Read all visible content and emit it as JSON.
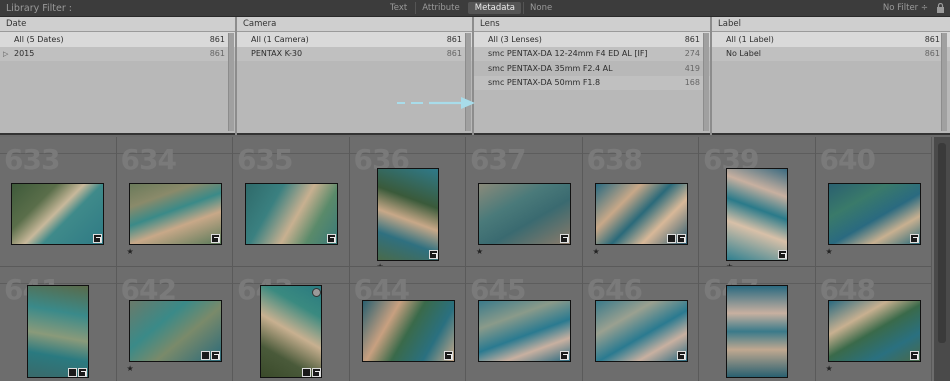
{
  "filterbar": {
    "title": "Library Filter :",
    "modes": [
      "Text",
      "Attribute",
      "Metadata",
      "None"
    ],
    "active_mode": "Metadata",
    "preset": "No Filter ÷"
  },
  "columns": [
    {
      "header": "Date",
      "rows": [
        {
          "label": "All (5 Dates)",
          "count": "861",
          "selected": true
        },
        {
          "label": "2015",
          "count": "861",
          "selected": false
        }
      ]
    },
    {
      "header": "Camera",
      "rows": [
        {
          "label": "All (1 Camera)",
          "count": "861",
          "selected": true
        },
        {
          "label": "PENTAX K-30",
          "count": "861",
          "selected": false
        }
      ]
    },
    {
      "header": "Lens",
      "rows": [
        {
          "label": "All (3 Lenses)",
          "count": "861",
          "selected": true
        },
        {
          "label": "smc PENTAX-DA 12-24mm F4 ED AL [IF]",
          "count": "274",
          "selected": false
        },
        {
          "label": "smc PENTAX-DA 35mm F2.4 AL",
          "count": "419",
          "selected": false
        },
        {
          "label": "smc PENTAX-DA 50mm F1.8",
          "count": "168",
          "selected": false
        }
      ]
    },
    {
      "header": "Label",
      "rows": [
        {
          "label": "All (1 Label)",
          "count": "861",
          "selected": true
        },
        {
          "label": "No Label",
          "count": "861",
          "selected": false
        }
      ]
    }
  ],
  "grid": {
    "row1": [
      "633",
      "634",
      "635",
      "636",
      "637",
      "638",
      "639",
      "640"
    ],
    "row2": [
      "641",
      "642",
      "643",
      "644",
      "645",
      "646",
      "647",
      "648"
    ]
  },
  "colors": {
    "accent_arrow": "#a8d8e8",
    "water": "#2e7a8a",
    "land": "#8a7a5a"
  }
}
